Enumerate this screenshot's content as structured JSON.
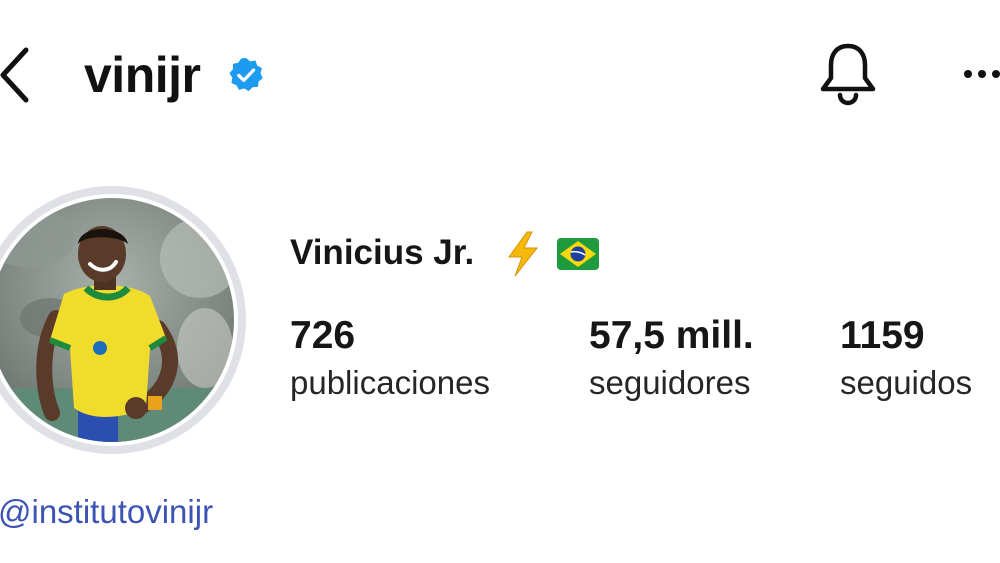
{
  "header": {
    "username": "vinijr",
    "verified": true,
    "icons": {
      "back": "chevron-left-icon",
      "verified": "verified-badge-icon",
      "notifications": "bell-icon",
      "more": "more-horizontal-icon"
    }
  },
  "profile": {
    "display_name": "Vinicius Jr.",
    "name_emojis": [
      "high-voltage-emoji",
      "brazil-flag-emoji"
    ],
    "avatar": "profile-photo-player-in-yellow-jersey",
    "link": "@institutovinijr"
  },
  "stats": {
    "posts": {
      "value": "726",
      "label": "publicaciones"
    },
    "followers": {
      "value": "57,5 mill.",
      "label": "seguidores"
    },
    "following": {
      "value": "1159",
      "label": "seguidos"
    }
  },
  "colors": {
    "text": "#161616",
    "verified_blue": "#1d9bf0",
    "link_blue": "#3b53b5",
    "avatar_ring": "#dfe1e6",
    "bolt_yellow": "#f6b90b"
  }
}
